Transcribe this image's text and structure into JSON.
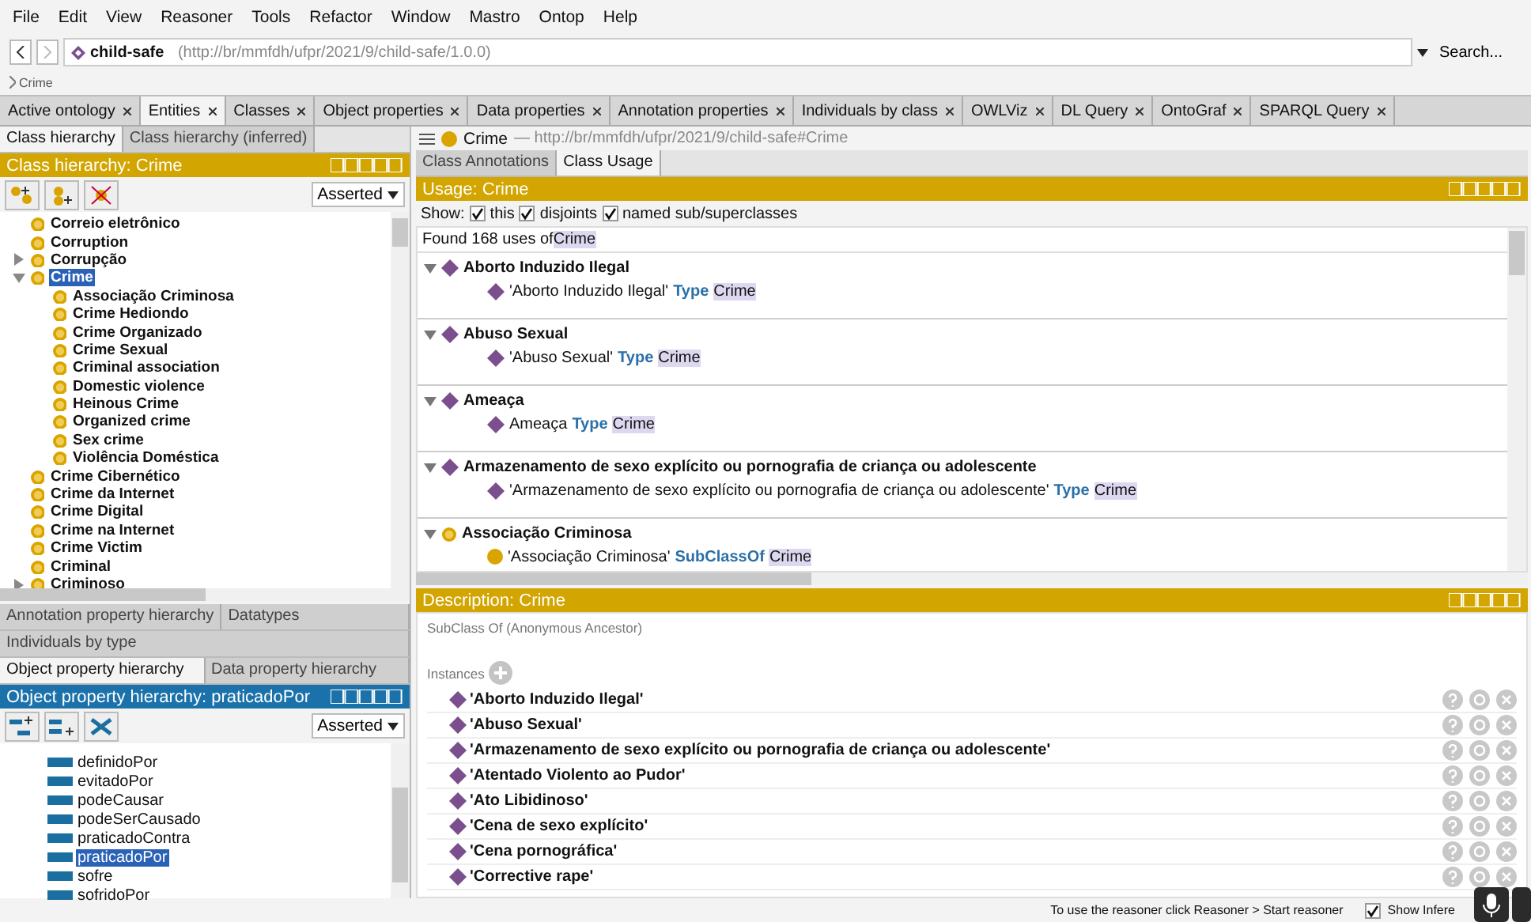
{
  "menu": [
    "File",
    "Edit",
    "View",
    "Reasoner",
    "Tools",
    "Refactor",
    "Window",
    "Mastro",
    "Ontop",
    "Help"
  ],
  "nav": {
    "ontology_name": "child-safe",
    "ontology_iri": "(http://br/mmfdh/ufpr/2021/9/child-safe/1.0.0)",
    "search": "Search..."
  },
  "breadcrumb": "Crime",
  "tabs": [
    {
      "label": "Active ontology",
      "selected": false
    },
    {
      "label": "Entities",
      "selected": true
    },
    {
      "label": "Classes",
      "selected": false
    },
    {
      "label": "Object properties",
      "selected": false
    },
    {
      "label": "Data properties",
      "selected": false
    },
    {
      "label": "Annotation properties",
      "selected": false
    },
    {
      "label": "Individuals by class",
      "selected": false
    },
    {
      "label": "OWLViz",
      "selected": false
    },
    {
      "label": "DL Query",
      "selected": false
    },
    {
      "label": "OntoGraf",
      "selected": false
    },
    {
      "label": "SPARQL Query",
      "selected": false
    }
  ],
  "class_panel": {
    "tabs": [
      {
        "label": "Class hierarchy",
        "selected": true
      },
      {
        "label": "Class hierarchy (inferred)",
        "selected": false
      }
    ],
    "header": "Class hierarchy: Crime",
    "mode": "Asserted",
    "tree": [
      {
        "label": "Correio eletrônico",
        "selected": false
      },
      {
        "label": "Corruption",
        "selected": false
      },
      {
        "label": "Corrupção",
        "selected": false,
        "expanded": false
      },
      {
        "label": "Crime",
        "selected": true,
        "expanded": true,
        "children": [
          {
            "label": "Associação Criminosa",
            "selected": false
          },
          {
            "label": "Crime Hediondo",
            "selected": false
          },
          {
            "label": "Crime Organizado",
            "selected": false
          },
          {
            "label": "Crime Sexual",
            "selected": false
          },
          {
            "label": "Criminal association",
            "selected": false
          },
          {
            "label": "Domestic violence",
            "selected": false
          },
          {
            "label": "Heinous Crime",
            "selected": false
          },
          {
            "label": "Organized crime",
            "selected": false
          },
          {
            "label": "Sex crime",
            "selected": false
          },
          {
            "label": "Violência Doméstica",
            "selected": false
          }
        ]
      },
      {
        "label": "Crime Cibernético",
        "selected": false
      },
      {
        "label": "Crime da Internet",
        "selected": false
      },
      {
        "label": "Crime Digital",
        "selected": false
      },
      {
        "label": "Crime na Internet",
        "selected": false
      },
      {
        "label": "Crime Victim",
        "selected": false
      },
      {
        "label": "Criminal",
        "selected": false
      },
      {
        "label": "Criminoso",
        "selected": false,
        "expanded": false
      }
    ]
  },
  "property_panel": {
    "tab_rows": [
      [
        {
          "label": "Annotation property hierarchy",
          "selected": false
        },
        {
          "label": "Datatypes",
          "selected": false
        }
      ],
      [
        {
          "label": "Individuals by type",
          "selected": false
        }
      ],
      [
        {
          "label": "Object property hierarchy",
          "selected": true
        },
        {
          "label": "Data property hierarchy",
          "selected": false
        }
      ]
    ],
    "header": "Object property hierarchy: praticadoPor",
    "mode": "Asserted",
    "items": [
      {
        "label": "definidoPor",
        "selected": false
      },
      {
        "label": "evitadoPor",
        "selected": false
      },
      {
        "label": "podeCausar",
        "selected": false
      },
      {
        "label": "podeSerCausado",
        "selected": false
      },
      {
        "label": "praticadoContra",
        "selected": false
      },
      {
        "label": "praticadoPor",
        "selected": true
      },
      {
        "label": "sofre",
        "selected": false
      },
      {
        "label": "sofridoPor",
        "selected": false
      }
    ]
  },
  "entity": {
    "name": "Crime",
    "iri": "— http://br/mmfdh/ufpr/2021/9/child-safe#Crime"
  },
  "entity_tabs": [
    {
      "label": "Class Annotations",
      "selected": false
    },
    {
      "label": "Class Usage",
      "selected": true
    }
  ],
  "usage": {
    "header": "Usage: Crime",
    "show_label": "Show:",
    "show_options": [
      {
        "label": "this",
        "checked": true
      },
      {
        "label": "disjoints",
        "checked": true
      },
      {
        "label": "named sub/superclasses",
        "checked": true
      }
    ],
    "found": "Found 168 uses of",
    "found_entity": "Crime",
    "groups": [
      {
        "kind": "individual",
        "title": "Aborto Induzido Ilegal",
        "subject": "'Aborto Induzido Ilegal'",
        "keyword": "Type",
        "object": "Crime"
      },
      {
        "kind": "individual",
        "title": "Abuso Sexual",
        "subject": "'Abuso Sexual'",
        "keyword": "Type",
        "object": "Crime"
      },
      {
        "kind": "individual",
        "title": "Ameaça",
        "subject": "Ameaça",
        "keyword": "Type",
        "object": "Crime"
      },
      {
        "kind": "individual",
        "title": "Armazenamento de sexo explícito ou pornografia de criança ou adolescente",
        "subject": "'Armazenamento de sexo explícito ou pornografia de criança ou adolescente'",
        "keyword": "Type",
        "object": "Crime"
      },
      {
        "kind": "class",
        "title": "Associação Criminosa",
        "subject": "'Associação Criminosa'",
        "keyword": "SubClassOf",
        "object": "Crime"
      }
    ]
  },
  "description": {
    "header": "Description: Crime",
    "section": "SubClass Of (Anonymous Ancestor)",
    "instances_label": "Instances",
    "instances": [
      "'Aborto Induzido Ilegal'",
      "'Abuso Sexual'",
      "'Armazenamento de sexo explícito ou pornografia de criança ou adolescente'",
      "'Atentado Violento ao Pudor'",
      "'Ato Libidinoso'",
      "'Cena de sexo explícito'",
      "'Cena pornográfica'",
      "'Corrective rape'"
    ]
  },
  "status": {
    "text": "To use the reasoner click Reasoner > Start reasoner",
    "show_inferences": {
      "label": "Show Infere",
      "checked": true
    }
  }
}
